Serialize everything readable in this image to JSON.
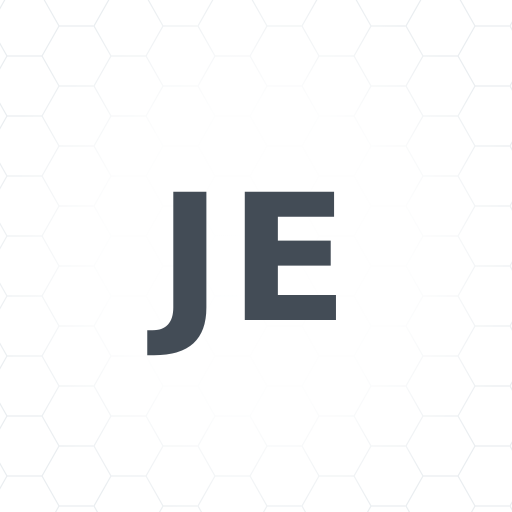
{
  "avatar": {
    "initials": "JE",
    "text_color": "#434c56",
    "background_color": "#ffffff",
    "pattern_color": "#e9edf0"
  }
}
